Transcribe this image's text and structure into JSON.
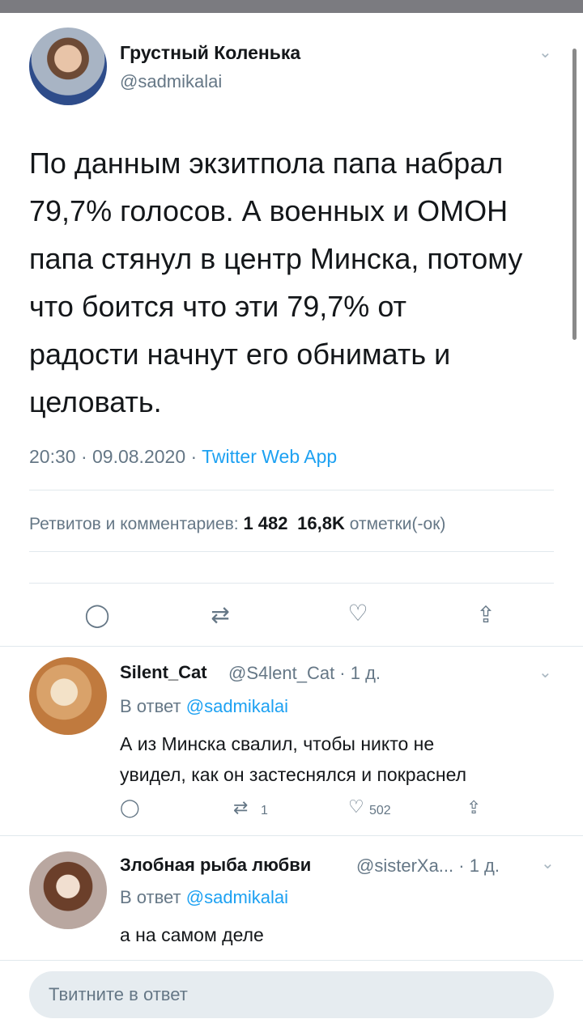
{
  "main_tweet": {
    "author_name": "Грустный Коленька",
    "handle": "@sadmikalai",
    "text": "По данным экзитпола папа набрал\n79,7% голосов. А военных и ОМОН\nпапа стянул в центр Минска, потому\nчто боится что эти 79,7% от\nрадости начнут его обнимать и\nцеловать.",
    "time_date": "20:30 · 09.08.2020 · ",
    "source_app": "Twitter Web App",
    "stats": {
      "retweets_label": "Ретвитов и комментариев:",
      "retweets_count": "1 482",
      "likes_count": "16,8K",
      "likes_label": "отметки(-ок)"
    }
  },
  "replies": [
    {
      "author_name": "Silent_Cat",
      "handle_time": "@S4lent_Cat · 1 д.",
      "reply_to_prefix": "В ответ ",
      "reply_to_handle": "@sadmikalai",
      "text": "А из Минска свалил, чтобы никто не\nувидел, как он застеснялся и покраснел",
      "retweet_count": "1",
      "like_count": "502"
    },
    {
      "author_name": "Злобная рыба любви",
      "handle_time": "@sisterXa... · 1 д.",
      "reply_to_prefix": "В ответ ",
      "reply_to_handle": "@sadmikalai",
      "text": "а на самом деле"
    }
  ],
  "composer": {
    "placeholder": "Твитните в ответ"
  },
  "icons": {
    "chevron": "⌄",
    "reply": "◯",
    "retweet": "⇄",
    "like": "♡",
    "share": "⇪"
  }
}
